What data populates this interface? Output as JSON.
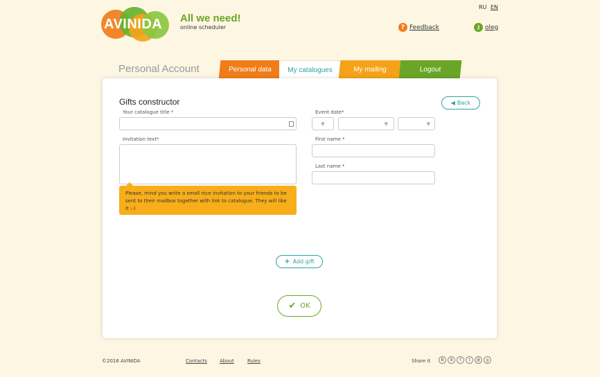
{
  "header": {
    "logo_text": "AVINIDA",
    "tagline": "All we need!",
    "subtagline": "online scheduler",
    "lang_ru": "RU",
    "lang_en": "EN",
    "feedback_label": "Feedback",
    "user_label": "oleg"
  },
  "account": {
    "title": "Personal Account",
    "tabs": [
      {
        "label": "Personal data"
      },
      {
        "label": "My catalogues"
      },
      {
        "label": "My mailing"
      },
      {
        "label": "Logout"
      }
    ]
  },
  "form": {
    "title": "Gifts constructor",
    "back_label": "Back",
    "catalogue_title_label": "Your catalogue title *",
    "catalogue_title_value": "",
    "invitation_label": "Invitation text*",
    "invitation_value": "",
    "tooltip_text": "Please, mind you write a small nice invitation to your friends to be sent to their mailbox together with link to catalogue. They will like it :-)",
    "event_date_label": "Event date*",
    "first_name_label": "First name *",
    "first_name_value": "",
    "last_name_label": "Last name *",
    "last_name_value": "",
    "add_gift_label": "Add gift",
    "ok_label": "OK"
  },
  "footer": {
    "copyright": "©2016 AVINIDA",
    "links": [
      {
        "label": "Contacts"
      },
      {
        "label": "About"
      },
      {
        "label": "Rules"
      }
    ],
    "share_label": "Share it",
    "social_icons": [
      "blog-icon",
      "odnoklassniki-icon",
      "facebook-icon",
      "twitter-icon",
      "mail-icon",
      "googleplus-icon"
    ]
  },
  "colors": {
    "orange": "#f07d1a",
    "yellow": "#f5a21a",
    "green": "#6aa527",
    "teal": "#2aa3a0",
    "background": "#fdf6e3"
  }
}
